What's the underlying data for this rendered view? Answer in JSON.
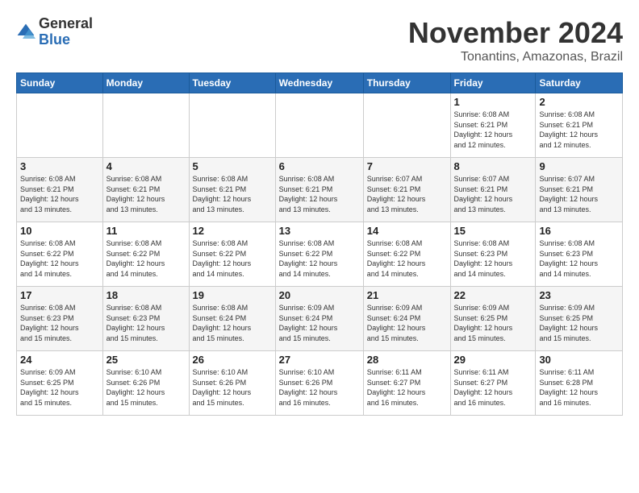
{
  "logo": {
    "general": "General",
    "blue": "Blue"
  },
  "title": "November 2024",
  "subtitle": "Tonantins, Amazonas, Brazil",
  "headers": [
    "Sunday",
    "Monday",
    "Tuesday",
    "Wednesday",
    "Thursday",
    "Friday",
    "Saturday"
  ],
  "weeks": [
    [
      {
        "day": "",
        "info": ""
      },
      {
        "day": "",
        "info": ""
      },
      {
        "day": "",
        "info": ""
      },
      {
        "day": "",
        "info": ""
      },
      {
        "day": "",
        "info": ""
      },
      {
        "day": "1",
        "info": "Sunrise: 6:08 AM\nSunset: 6:21 PM\nDaylight: 12 hours\nand 12 minutes."
      },
      {
        "day": "2",
        "info": "Sunrise: 6:08 AM\nSunset: 6:21 PM\nDaylight: 12 hours\nand 12 minutes."
      }
    ],
    [
      {
        "day": "3",
        "info": "Sunrise: 6:08 AM\nSunset: 6:21 PM\nDaylight: 12 hours\nand 13 minutes."
      },
      {
        "day": "4",
        "info": "Sunrise: 6:08 AM\nSunset: 6:21 PM\nDaylight: 12 hours\nand 13 minutes."
      },
      {
        "day": "5",
        "info": "Sunrise: 6:08 AM\nSunset: 6:21 PM\nDaylight: 12 hours\nand 13 minutes."
      },
      {
        "day": "6",
        "info": "Sunrise: 6:08 AM\nSunset: 6:21 PM\nDaylight: 12 hours\nand 13 minutes."
      },
      {
        "day": "7",
        "info": "Sunrise: 6:07 AM\nSunset: 6:21 PM\nDaylight: 12 hours\nand 13 minutes."
      },
      {
        "day": "8",
        "info": "Sunrise: 6:07 AM\nSunset: 6:21 PM\nDaylight: 12 hours\nand 13 minutes."
      },
      {
        "day": "9",
        "info": "Sunrise: 6:07 AM\nSunset: 6:21 PM\nDaylight: 12 hours\nand 13 minutes."
      }
    ],
    [
      {
        "day": "10",
        "info": "Sunrise: 6:08 AM\nSunset: 6:22 PM\nDaylight: 12 hours\nand 14 minutes."
      },
      {
        "day": "11",
        "info": "Sunrise: 6:08 AM\nSunset: 6:22 PM\nDaylight: 12 hours\nand 14 minutes."
      },
      {
        "day": "12",
        "info": "Sunrise: 6:08 AM\nSunset: 6:22 PM\nDaylight: 12 hours\nand 14 minutes."
      },
      {
        "day": "13",
        "info": "Sunrise: 6:08 AM\nSunset: 6:22 PM\nDaylight: 12 hours\nand 14 minutes."
      },
      {
        "day": "14",
        "info": "Sunrise: 6:08 AM\nSunset: 6:22 PM\nDaylight: 12 hours\nand 14 minutes."
      },
      {
        "day": "15",
        "info": "Sunrise: 6:08 AM\nSunset: 6:23 PM\nDaylight: 12 hours\nand 14 minutes."
      },
      {
        "day": "16",
        "info": "Sunrise: 6:08 AM\nSunset: 6:23 PM\nDaylight: 12 hours\nand 14 minutes."
      }
    ],
    [
      {
        "day": "17",
        "info": "Sunrise: 6:08 AM\nSunset: 6:23 PM\nDaylight: 12 hours\nand 15 minutes."
      },
      {
        "day": "18",
        "info": "Sunrise: 6:08 AM\nSunset: 6:23 PM\nDaylight: 12 hours\nand 15 minutes."
      },
      {
        "day": "19",
        "info": "Sunrise: 6:08 AM\nSunset: 6:24 PM\nDaylight: 12 hours\nand 15 minutes."
      },
      {
        "day": "20",
        "info": "Sunrise: 6:09 AM\nSunset: 6:24 PM\nDaylight: 12 hours\nand 15 minutes."
      },
      {
        "day": "21",
        "info": "Sunrise: 6:09 AM\nSunset: 6:24 PM\nDaylight: 12 hours\nand 15 minutes."
      },
      {
        "day": "22",
        "info": "Sunrise: 6:09 AM\nSunset: 6:25 PM\nDaylight: 12 hours\nand 15 minutes."
      },
      {
        "day": "23",
        "info": "Sunrise: 6:09 AM\nSunset: 6:25 PM\nDaylight: 12 hours\nand 15 minutes."
      }
    ],
    [
      {
        "day": "24",
        "info": "Sunrise: 6:09 AM\nSunset: 6:25 PM\nDaylight: 12 hours\nand 15 minutes."
      },
      {
        "day": "25",
        "info": "Sunrise: 6:10 AM\nSunset: 6:26 PM\nDaylight: 12 hours\nand 15 minutes."
      },
      {
        "day": "26",
        "info": "Sunrise: 6:10 AM\nSunset: 6:26 PM\nDaylight: 12 hours\nand 15 minutes."
      },
      {
        "day": "27",
        "info": "Sunrise: 6:10 AM\nSunset: 6:26 PM\nDaylight: 12 hours\nand 16 minutes."
      },
      {
        "day": "28",
        "info": "Sunrise: 6:11 AM\nSunset: 6:27 PM\nDaylight: 12 hours\nand 16 minutes."
      },
      {
        "day": "29",
        "info": "Sunrise: 6:11 AM\nSunset: 6:27 PM\nDaylight: 12 hours\nand 16 minutes."
      },
      {
        "day": "30",
        "info": "Sunrise: 6:11 AM\nSunset: 6:28 PM\nDaylight: 12 hours\nand 16 minutes."
      }
    ]
  ]
}
